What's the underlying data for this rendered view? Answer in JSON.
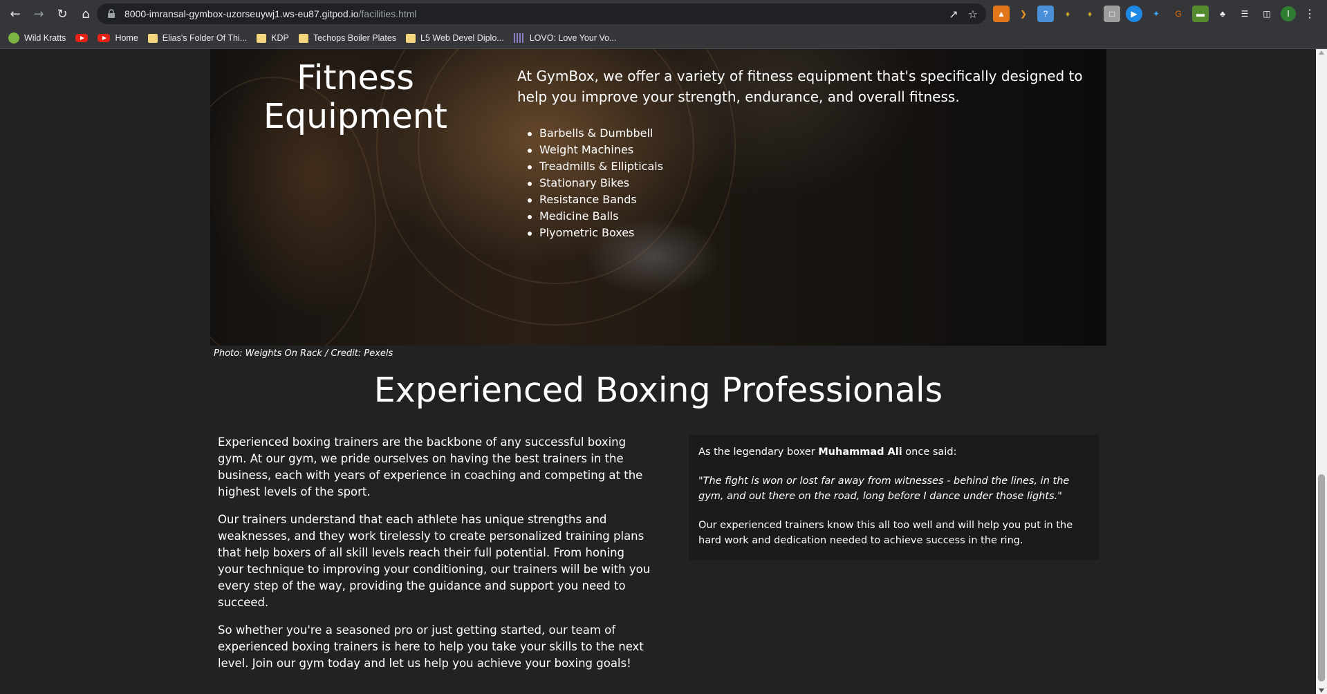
{
  "browser": {
    "url_host": "8000-imransal-gymbox-uzorseuywj1.ws-eu87.gitpod.io",
    "url_path": "/facilities.html",
    "profile_initial": "I",
    "bookmarks": [
      {
        "label": "Wild Kratts",
        "icon": "wild-kratts-icon"
      },
      {
        "label": "",
        "icon": "youtube-icon"
      },
      {
        "label": "Home",
        "icon": "youtube-icon"
      },
      {
        "label": "Elias's Folder Of Thi...",
        "icon": "folder-icon"
      },
      {
        "label": "KDP",
        "icon": "folder-icon"
      },
      {
        "label": "Techops Boiler Plates",
        "icon": "folder-icon"
      },
      {
        "label": "L5 Web Devel Diplo...",
        "icon": "folder-icon"
      },
      {
        "label": "LOVO: Love Your Vo...",
        "icon": "lovo-icon"
      }
    ]
  },
  "hero": {
    "title_line1": "Fitness",
    "title_line2": "Equipment",
    "intro": "At GymBox, we offer a variety of fitness equipment that's specifically designed to help you improve your strength, endurance, and overall fitness.",
    "items": [
      "Barbells & Dumbbell",
      "Weight Machines",
      "Treadmills & Ellipticals",
      "Stationary Bikes",
      "Resistance Bands",
      "Medicine Balls",
      "Plyometric Boxes"
    ],
    "caption": "Photo: Weights On Rack / Credit: Pexels"
  },
  "trainers": {
    "title": "Experienced Boxing Professionals",
    "paragraphs": [
      "Experienced boxing trainers are the backbone of any successful boxing gym. At our gym, we pride ourselves on having the best trainers in the business, each with years of experience in coaching and competing at the highest levels of the sport.",
      "Our trainers understand that each athlete has unique strengths and weaknesses, and they work tirelessly to create personalized training plans that help boxers of all skill levels reach their full potential. From honing your technique to improving your conditioning, our trainers will be with you every step of the way, providing the guidance and support you need to succeed.",
      "So whether you're a seasoned pro or just getting started, our team of experienced boxing trainers is here to help you take your skills to the next level. Join our gym today and let us help you achieve your boxing goals!"
    ],
    "quote_intro_before": "As the legendary boxer ",
    "quote_name": "Muhammad Ali",
    "quote_intro_after": " once said:",
    "quote": "\"The fight is won or lost far away from witnesses - behind the lines, in the gym, and out there on the road, long before I dance under those lights.\"",
    "quote_followup": "Our experienced trainers know this all too well and will help you put in the hard work and dedication needed to achieve success in the ring."
  }
}
